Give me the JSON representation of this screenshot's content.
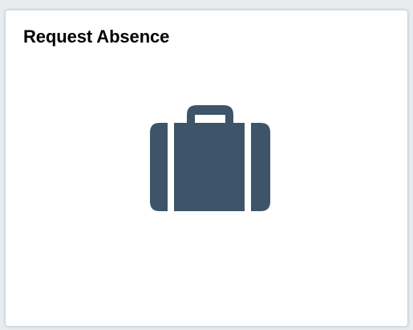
{
  "tile": {
    "title": "Request Absence",
    "icon": "briefcase-icon",
    "icon_color": "#3e5468",
    "background": "#ffffff",
    "border_color": "#cfd6dd"
  }
}
